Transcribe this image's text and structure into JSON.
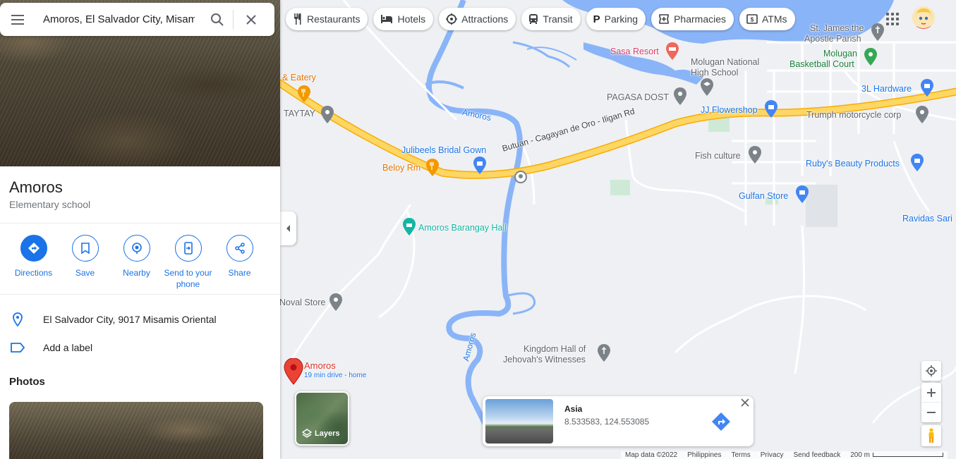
{
  "search": {
    "value": "Amoros, El Salvador City, Misamis Oriental"
  },
  "place": {
    "title": "Amoros",
    "category": "Elementary school"
  },
  "actions": [
    {
      "label": "Directions"
    },
    {
      "label": "Save"
    },
    {
      "label": "Nearby"
    },
    {
      "label": "Send to your phone"
    },
    {
      "label": "Share"
    }
  ],
  "info": {
    "address": "El Salvador City, 9017 Misamis Oriental",
    "add_label": "Add a label"
  },
  "photos": {
    "heading": "Photos"
  },
  "chips": [
    "Restaurants",
    "Hotels",
    "Attractions",
    "Transit",
    "Parking",
    "Pharmacies",
    "ATMs"
  ],
  "map_labels": {
    "eatery": "& Eatery",
    "taytay": "TAYTAY",
    "amoros_river": "Amoros",
    "amoros_river2": "Amoros",
    "road": "Butuan - Cagayan de Oro - Iligan Rd",
    "julibeels": "Julibeels Bridal Gown",
    "beloy": "Beloy Rm",
    "barangay_hall": "Amoros Barangay Hall",
    "noval": "Noval Store",
    "kingdom1": "Kingdom Hall of",
    "kingdom2": "Jehovah's Witnesses",
    "sasa": "Sasa Resort",
    "james1": "St. James the",
    "james2": "Apostle Parish",
    "molugan_school1": "Molugan National",
    "molugan_school2": "High School",
    "molugan_court1": "Molugan",
    "molugan_court2": "Basketball Court",
    "pagasa": "PAGASA DOST",
    "flowershop": "JJ Flowershop",
    "hardware": "3L Hardware",
    "trumph": "Trumph motorcycle corp",
    "fish": "Fish culture",
    "rubys": "Ruby's Beauty Products",
    "gulfan": "Gulfan Store",
    "ravidas": "Ravidas Sari",
    "pin_name": "Amoros",
    "pin_sub": "19 min drive - home"
  },
  "layers": {
    "label": "Layers"
  },
  "streetview": {
    "title": "Asia",
    "coords": "8.533583, 124.553085"
  },
  "footer": {
    "mapdata": "Map data ©2022",
    "country": "Philippines",
    "terms": "Terms",
    "privacy": "Privacy",
    "feedback": "Send feedback",
    "scale": "200 m"
  },
  "colors": {
    "accent": "#1a73e8",
    "road": "#fdd663",
    "water": "#8ab4f8",
    "pin": "#ea4335"
  }
}
